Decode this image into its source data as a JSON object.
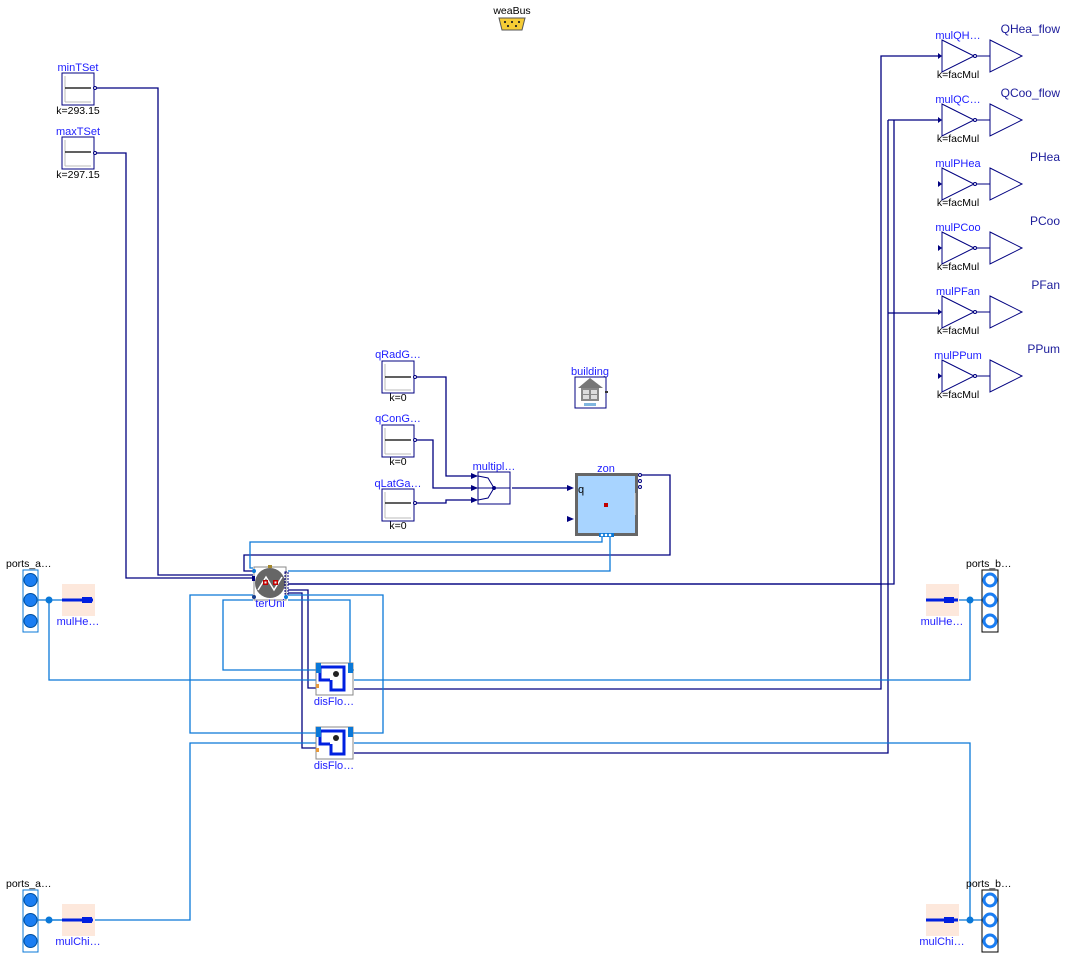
{
  "diagram": {
    "top": {
      "weather_bus": {
        "label": "weaBus",
        "icon": "serial-connector-icon",
        "color": "#f6cc35"
      }
    },
    "setpoints": [
      {
        "name": "minTSet",
        "param": "k=293.15"
      },
      {
        "name": "maxTSet",
        "param": "k=297.15"
      }
    ],
    "gains": [
      {
        "name": "qRadG…",
        "param": "k=0"
      },
      {
        "name": "qConG…",
        "param": "k=0"
      },
      {
        "name": "qLatGa…",
        "param": "k=0"
      }
    ],
    "multiplex": {
      "name": "multipl…"
    },
    "building": {
      "name": "building",
      "icon": "house-icon"
    },
    "zone": {
      "name": "zon",
      "port_label": "q",
      "fill_color": "#a8d4ff"
    },
    "terminal_unit": {
      "name": "terUni",
      "icon": "fan-coil-icon"
    },
    "distribution": [
      {
        "name": "disFlo…"
      },
      {
        "name": "disFlo…"
      }
    ],
    "multipliers": [
      {
        "name": "mulQH…",
        "param": "k=facMul",
        "output": "QHea_flow"
      },
      {
        "name": "mulQC…",
        "param": "k=facMul",
        "output": "QCoo_flow"
      },
      {
        "name": "mulPHea",
        "param": "k=facMul",
        "output": "PHea"
      },
      {
        "name": "mulPCoo",
        "param": "k=facMul",
        "output": "PCoo"
      },
      {
        "name": "mulPFan",
        "param": "k=facMul",
        "output": "PFan"
      },
      {
        "name": "mulPPum",
        "param": "k=facMul",
        "output": "PPum"
      }
    ],
    "fluid_ports": {
      "heating_a": {
        "ports": "ports_a…",
        "mult": "mulHe…"
      },
      "heating_b": {
        "ports": "ports_b…",
        "mult": "mulHe…"
      },
      "chilled_a": {
        "ports": "ports_a…",
        "mult": "mulChi…"
      },
      "chilled_b": {
        "ports": "ports_b…",
        "mult": "mulChi…"
      }
    },
    "colors": {
      "control_wire": "#000080",
      "fluid_wire": "#0a78d8",
      "label": "#1d1dff"
    }
  }
}
